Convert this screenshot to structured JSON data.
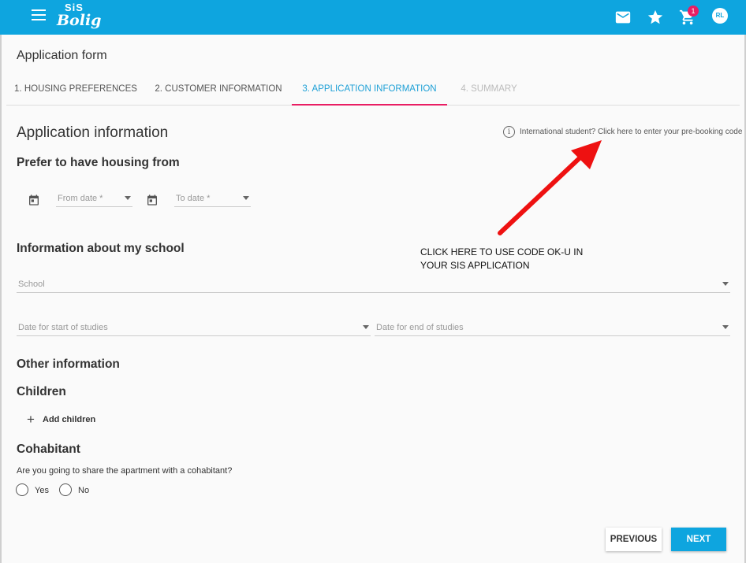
{
  "topbar": {
    "logo_top": "SiS",
    "logo_bottom": "Bolig",
    "cart_count": "1",
    "avatar_initials": "RL",
    "accent_color": "#0ea5df",
    "icons": [
      "menu-icon",
      "mail-icon",
      "star-icon",
      "cart-icon"
    ]
  },
  "form_title": "Application form",
  "tabs": [
    {
      "label": "1. HOUSING PREFERENCES",
      "state": "done"
    },
    {
      "label": "2. CUSTOMER INFORMATION",
      "state": "done"
    },
    {
      "label": "3. APPLICATION INFORMATION",
      "state": "active"
    },
    {
      "label": "4. SUMMARY",
      "state": "disabled"
    }
  ],
  "main": {
    "title": "Application information",
    "prebooking_link": "International student? Click here to enter your pre-booking code",
    "housing": {
      "title": "Prefer to have housing from",
      "from_placeholder": "From date *",
      "to_placeholder": "To date *"
    },
    "school": {
      "title": "Information about my school",
      "school_placeholder": "School",
      "start_placeholder": "Date for start of studies",
      "end_placeholder": "Date for end of studies"
    },
    "other_title": "Other information",
    "children": {
      "title": "Children",
      "add_label": "Add children"
    },
    "cohabitant": {
      "title": "Cohabitant",
      "question": "Are you going to share the apartment with a cohabitant?",
      "options": [
        "Yes",
        "No"
      ]
    }
  },
  "annotation": {
    "line1": "CLICK HERE TO USE CODE OK-U IN",
    "line2": "YOUR SIS APPLICATION",
    "color": "#ee1111"
  },
  "buttons": {
    "previous": "PREVIOUS",
    "next": "NEXT"
  }
}
